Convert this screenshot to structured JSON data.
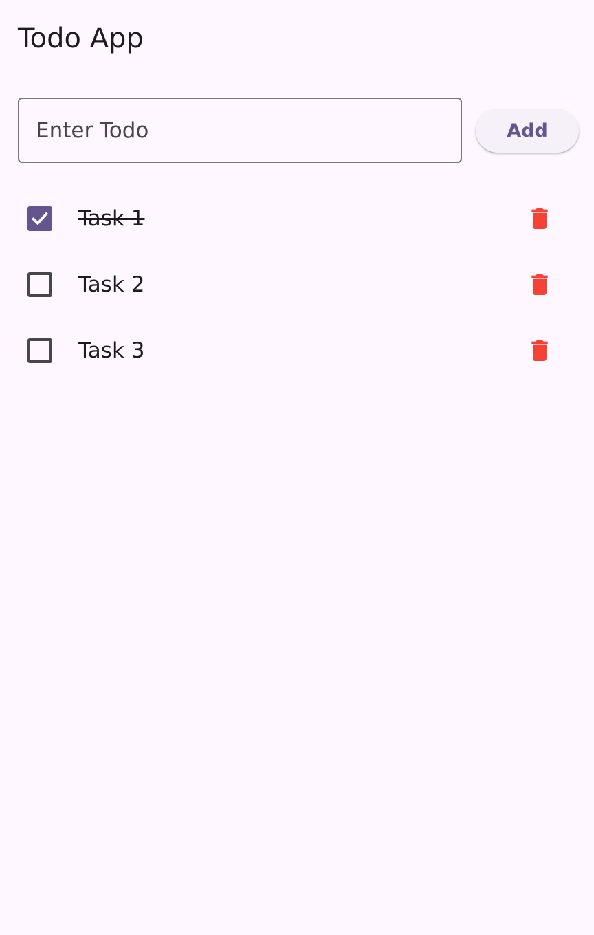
{
  "app": {
    "title": "Todo App"
  },
  "input": {
    "placeholder": "Enter Todo",
    "value": ""
  },
  "add_button": {
    "label": "Add"
  },
  "todos": [
    {
      "label": "Task 1",
      "done": true,
      "icon": "trash-icon"
    },
    {
      "label": "Task 2",
      "done": false,
      "icon": "trash-icon"
    },
    {
      "label": "Task 3",
      "done": false,
      "icon": "trash-icon"
    }
  ],
  "colors": {
    "background": "#fef7ff",
    "primary": "#65558f",
    "delete": "#f44336",
    "text": "#1d1b20",
    "outline": "#79747e"
  }
}
